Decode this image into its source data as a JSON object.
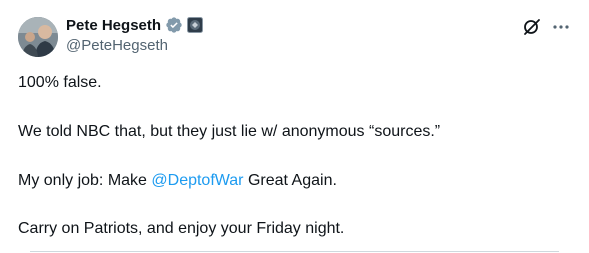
{
  "author": {
    "display_name": "Pete Hegseth",
    "handle": "@PeteHegseth",
    "verified_badge_icon": "verified-badge-icon",
    "affiliation_badge_icon": "government-seal-icon",
    "badge_color": "#829aab"
  },
  "actions": {
    "grok_icon": "grok-icon",
    "more_icon": "more-horizontal-icon"
  },
  "post": {
    "line1": "100% false.",
    "line2": "We told NBC that, but they just lie w/ anonymous “sources.”",
    "line3_before": "My only job: Make ",
    "line3_mention": "@DeptofWar",
    "line3_after": " Great Again.",
    "line4": "Carry on Patriots, and enjoy your Friday night."
  },
  "colors": {
    "text": "#0f1419",
    "secondary": "#536471",
    "link": "#1d9bf0"
  }
}
